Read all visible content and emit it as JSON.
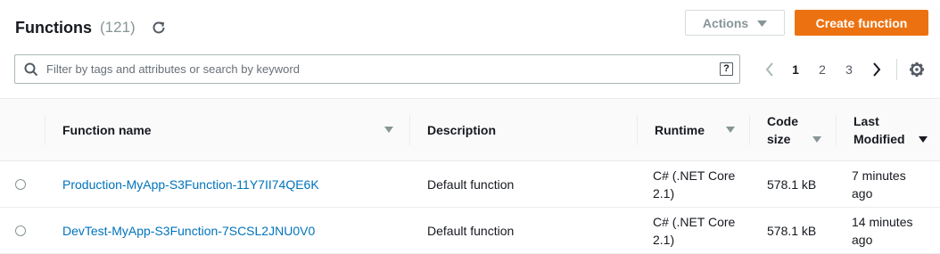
{
  "header": {
    "title": "Functions",
    "count": "(121)"
  },
  "toolbar": {
    "actions_label": "Actions",
    "create_label": "Create function"
  },
  "search": {
    "placeholder": "Filter by tags and attributes or search by keyword",
    "value": ""
  },
  "pagination": {
    "pages": [
      "1",
      "2",
      "3"
    ],
    "current": "1"
  },
  "table": {
    "columns": {
      "name": "Function name",
      "description": "Description",
      "runtime": "Runtime",
      "code_size_line1": "Code",
      "code_size_line2": "size",
      "last_modified_line1": "Last",
      "last_modified_line2": "Modified"
    },
    "rows": [
      {
        "name": "Production-MyApp-S3Function-11Y7II74QE6K",
        "description": "Default function",
        "runtime_line1": "C# (.NET Core",
        "runtime_line2": "2.1)",
        "code_size": "578.1 kB",
        "modified_line1": "7 minutes",
        "modified_line2": "ago"
      },
      {
        "name": "DevTest-MyApp-S3Function-7SCSL2JNU0V0",
        "description": "Default function",
        "runtime_line1": "C# (.NET Core",
        "runtime_line2": "2.1)",
        "code_size": "578.1 kB",
        "modified_line1": "14 minutes",
        "modified_line2": "ago"
      }
    ]
  },
  "icons": [
    "refresh-icon",
    "caret-down-icon",
    "search-icon",
    "help-icon",
    "chevron-left-icon",
    "chevron-right-icon",
    "gear-icon",
    "sort-icon"
  ],
  "colors": {
    "primary": "#ec7211",
    "link": "#0073bb",
    "muted": "#879596"
  }
}
